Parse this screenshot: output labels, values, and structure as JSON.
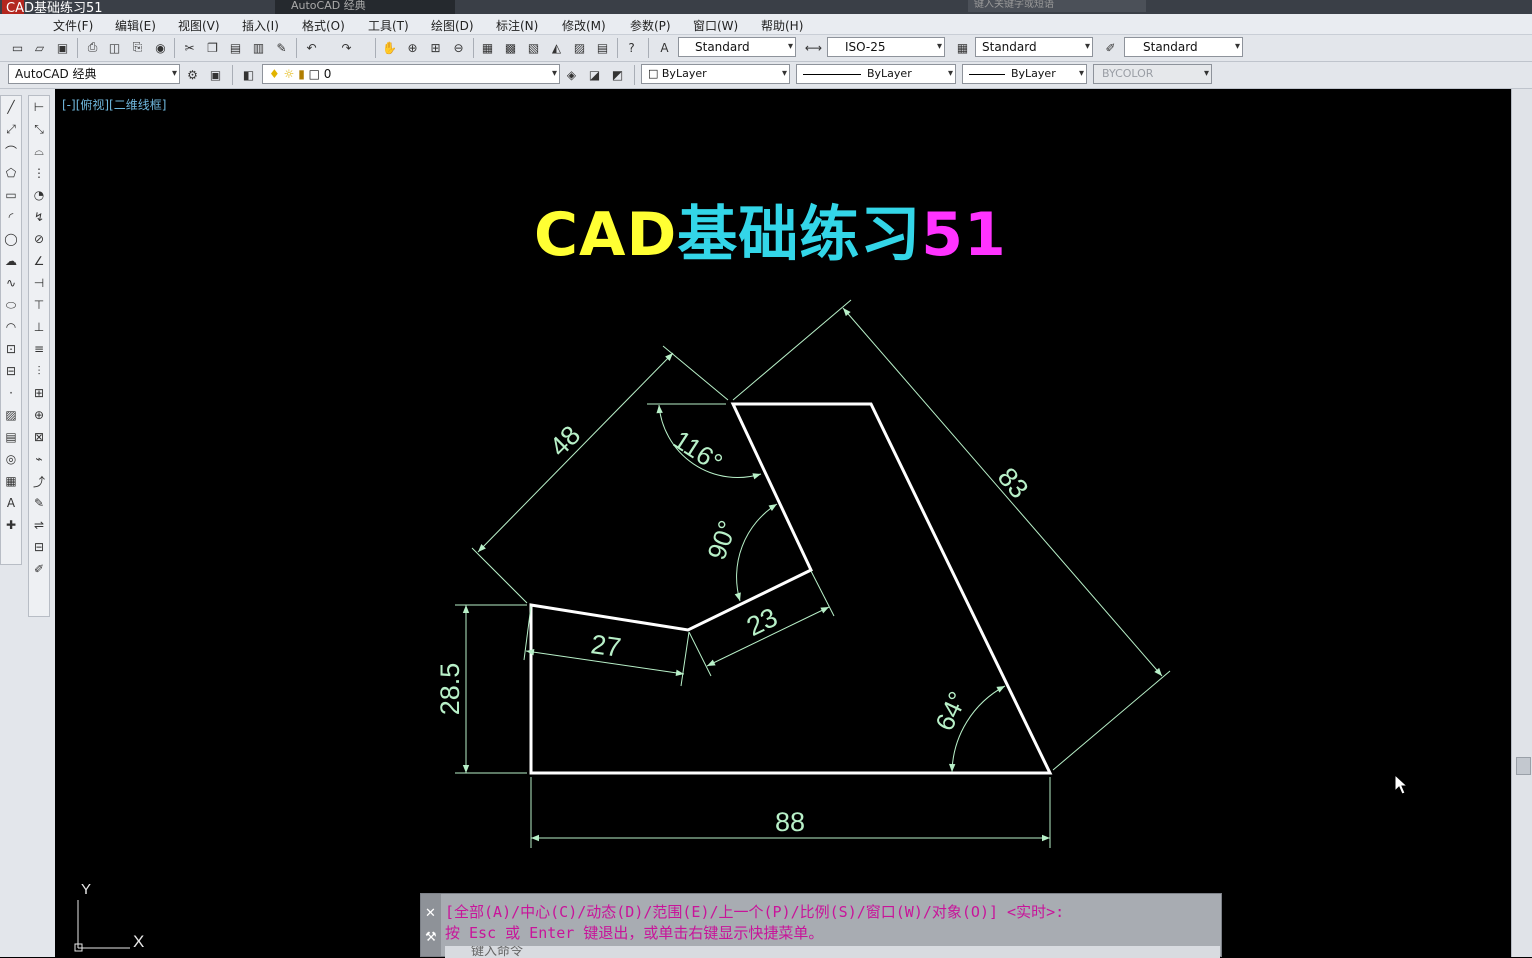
{
  "window": {
    "title": "CAD基础练习51",
    "workspace_small": "AutoCAD 经典",
    "search_placeholder": "键入关键字或短语"
  },
  "menu": [
    "文件(F)",
    "编辑(E)",
    "视图(V)",
    "插入(I)",
    "格式(O)",
    "工具(T)",
    "绘图(D)",
    "标注(N)",
    "修改(M)",
    "参数(P)",
    "窗口(W)",
    "帮助(H)"
  ],
  "toolbar1": {
    "text_style": "Standard",
    "dim_style": "ISO-25",
    "table_style": "Standard",
    "mleader_style": "Standard"
  },
  "toolbar2": {
    "workspace": "AutoCAD 经典",
    "layer": "0",
    "color": "ByLayer",
    "linetype": "ByLayer",
    "lineweight": "ByLayer",
    "plotstyle": "BYCOLOR"
  },
  "viewport_label": "[-][俯视][二维线框]",
  "drawing": {
    "title_part1": "CAD",
    "title_part2": "基础练习",
    "title_part3": "51",
    "dimensions": {
      "d48": "48",
      "d83": "83",
      "d116": "116°",
      "d90": "90°",
      "d27": "27",
      "d23": "23",
      "d28_5": "28.5",
      "d64": "64°",
      "d88": "88"
    },
    "ucs_y": "Y",
    "ucs_x": "X"
  },
  "command": {
    "line1": "[全部(A)/中心(C)/动态(D)/范围(E)/上一个(P)/比例(S)/窗口(W)/对象(O)] <实时>:",
    "line2": "按 Esc 或 Enter 键退出，或单击右键显示快捷菜单。",
    "input_placeholder": "键入命令"
  },
  "colors": {
    "background": "#000000",
    "outline": "#ffffff",
    "dimension": "#b8f0c8",
    "title_yellow": "#ffff33",
    "title_cyan": "#33d6e8",
    "title_magenta": "#ff33ff",
    "command_text": "#c8149a"
  }
}
